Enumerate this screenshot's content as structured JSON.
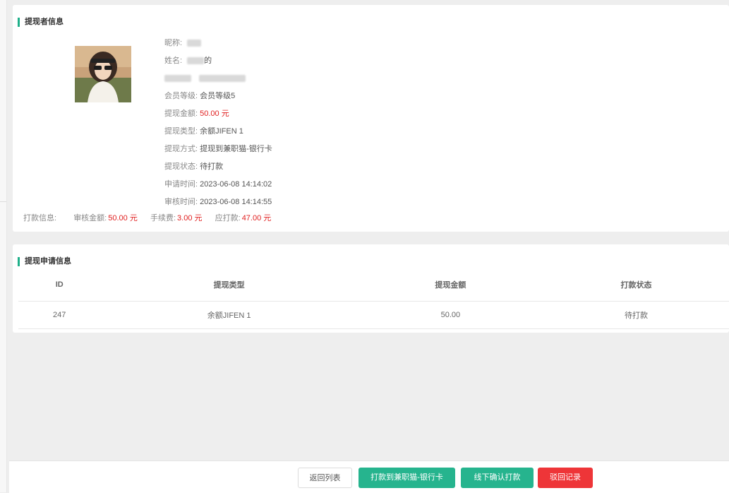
{
  "applicant": {
    "section_title": "提现者信息",
    "nickname_label": "昵称:",
    "name_label": "姓名:",
    "name_suffix": "的",
    "level_label": "会员等级:",
    "level_value": "会员等级5",
    "amount_label": "提现金额:",
    "amount_value": "50.00 元",
    "type_label": "提现类型:",
    "type_value": "余额JIFEN 1",
    "method_label": "提现方式:",
    "method_value": "提现到兼职猫-银行卡",
    "status_label": "提现状态:",
    "status_value": "待打款",
    "apply_time_label": "申请时间:",
    "apply_time_value": "2023-06-08 14:14:02",
    "review_time_label": "审核时间:",
    "review_time_value": "2023-06-08 14:14:55"
  },
  "payment": {
    "label": "打款信息:",
    "review_amount_label": "审核金额:",
    "review_amount_value": "50.00 元",
    "fee_label": "手续费:",
    "fee_value": "3.00 元",
    "payable_label": "应打款:",
    "payable_value": "47.00 元"
  },
  "request": {
    "section_title": "提现申请信息",
    "columns": [
      "ID",
      "提现类型",
      "提现金额",
      "打款状态"
    ],
    "rows": [
      [
        "247",
        "余额JIFEN 1",
        "50.00",
        "待打款"
      ]
    ]
  },
  "footer": {
    "back_label": "返回列表",
    "pay_label": "打款到兼职猫-银行卡",
    "offline_label": "线下确认打款",
    "reject_label": "驳回记录"
  },
  "colors": {
    "accent": "#26b48e",
    "danger": "#ee3538",
    "money": "#e02020"
  }
}
